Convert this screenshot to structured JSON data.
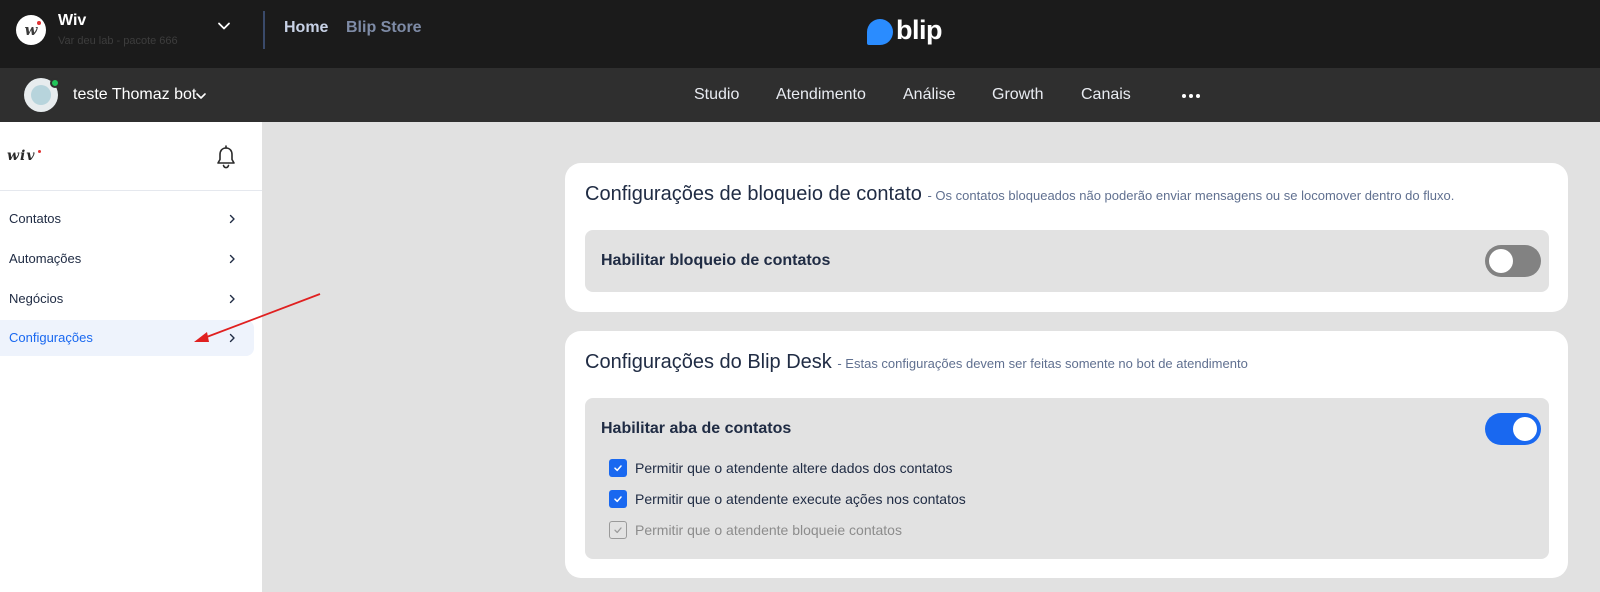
{
  "header": {
    "org_initial": "w",
    "org_name": "Wiv",
    "org_subtitle": "Var deu lab - pacote 666",
    "nav": [
      "Home",
      "Blip Store"
    ],
    "logo_text": "blip"
  },
  "botbar": {
    "bot_name": "teste Thomaz bot",
    "menu": [
      "Studio",
      "Atendimento",
      "Análise",
      "Growth",
      "Canais"
    ],
    "more_icon": "more-horizontal-icon"
  },
  "sidebar": {
    "logo_text": "wiv",
    "items": [
      {
        "label": "Contatos",
        "active": false
      },
      {
        "label": "Automações",
        "active": false
      },
      {
        "label": "Negócios",
        "active": false
      },
      {
        "label": "Configurações",
        "active": true
      }
    ]
  },
  "block_card": {
    "title": "Configurações de bloqueio de contato",
    "description": "- Os contatos bloqueados não poderão enviar mensagens ou se locomover dentro do fluxo.",
    "toggle_label": "Habilitar bloqueio de contatos",
    "toggle_on": false
  },
  "desk_card": {
    "title": "Configurações do Blip Desk",
    "description": "- Estas configurações devem ser feitas somente no bot de atendimento",
    "toggle_label": "Habilitar aba de contatos",
    "toggle_on": true,
    "options": [
      {
        "label": "Permitir que o atendente altere dados dos contatos",
        "checked": true,
        "disabled": false
      },
      {
        "label": "Permitir que o atendente execute ações nos contatos",
        "checked": true,
        "disabled": false
      },
      {
        "label": "Permitir que o atendente bloqueie contatos",
        "checked": true,
        "disabled": true
      }
    ]
  },
  "colors": {
    "accent": "#1968f0",
    "annotation_arrow": "#e02020"
  }
}
